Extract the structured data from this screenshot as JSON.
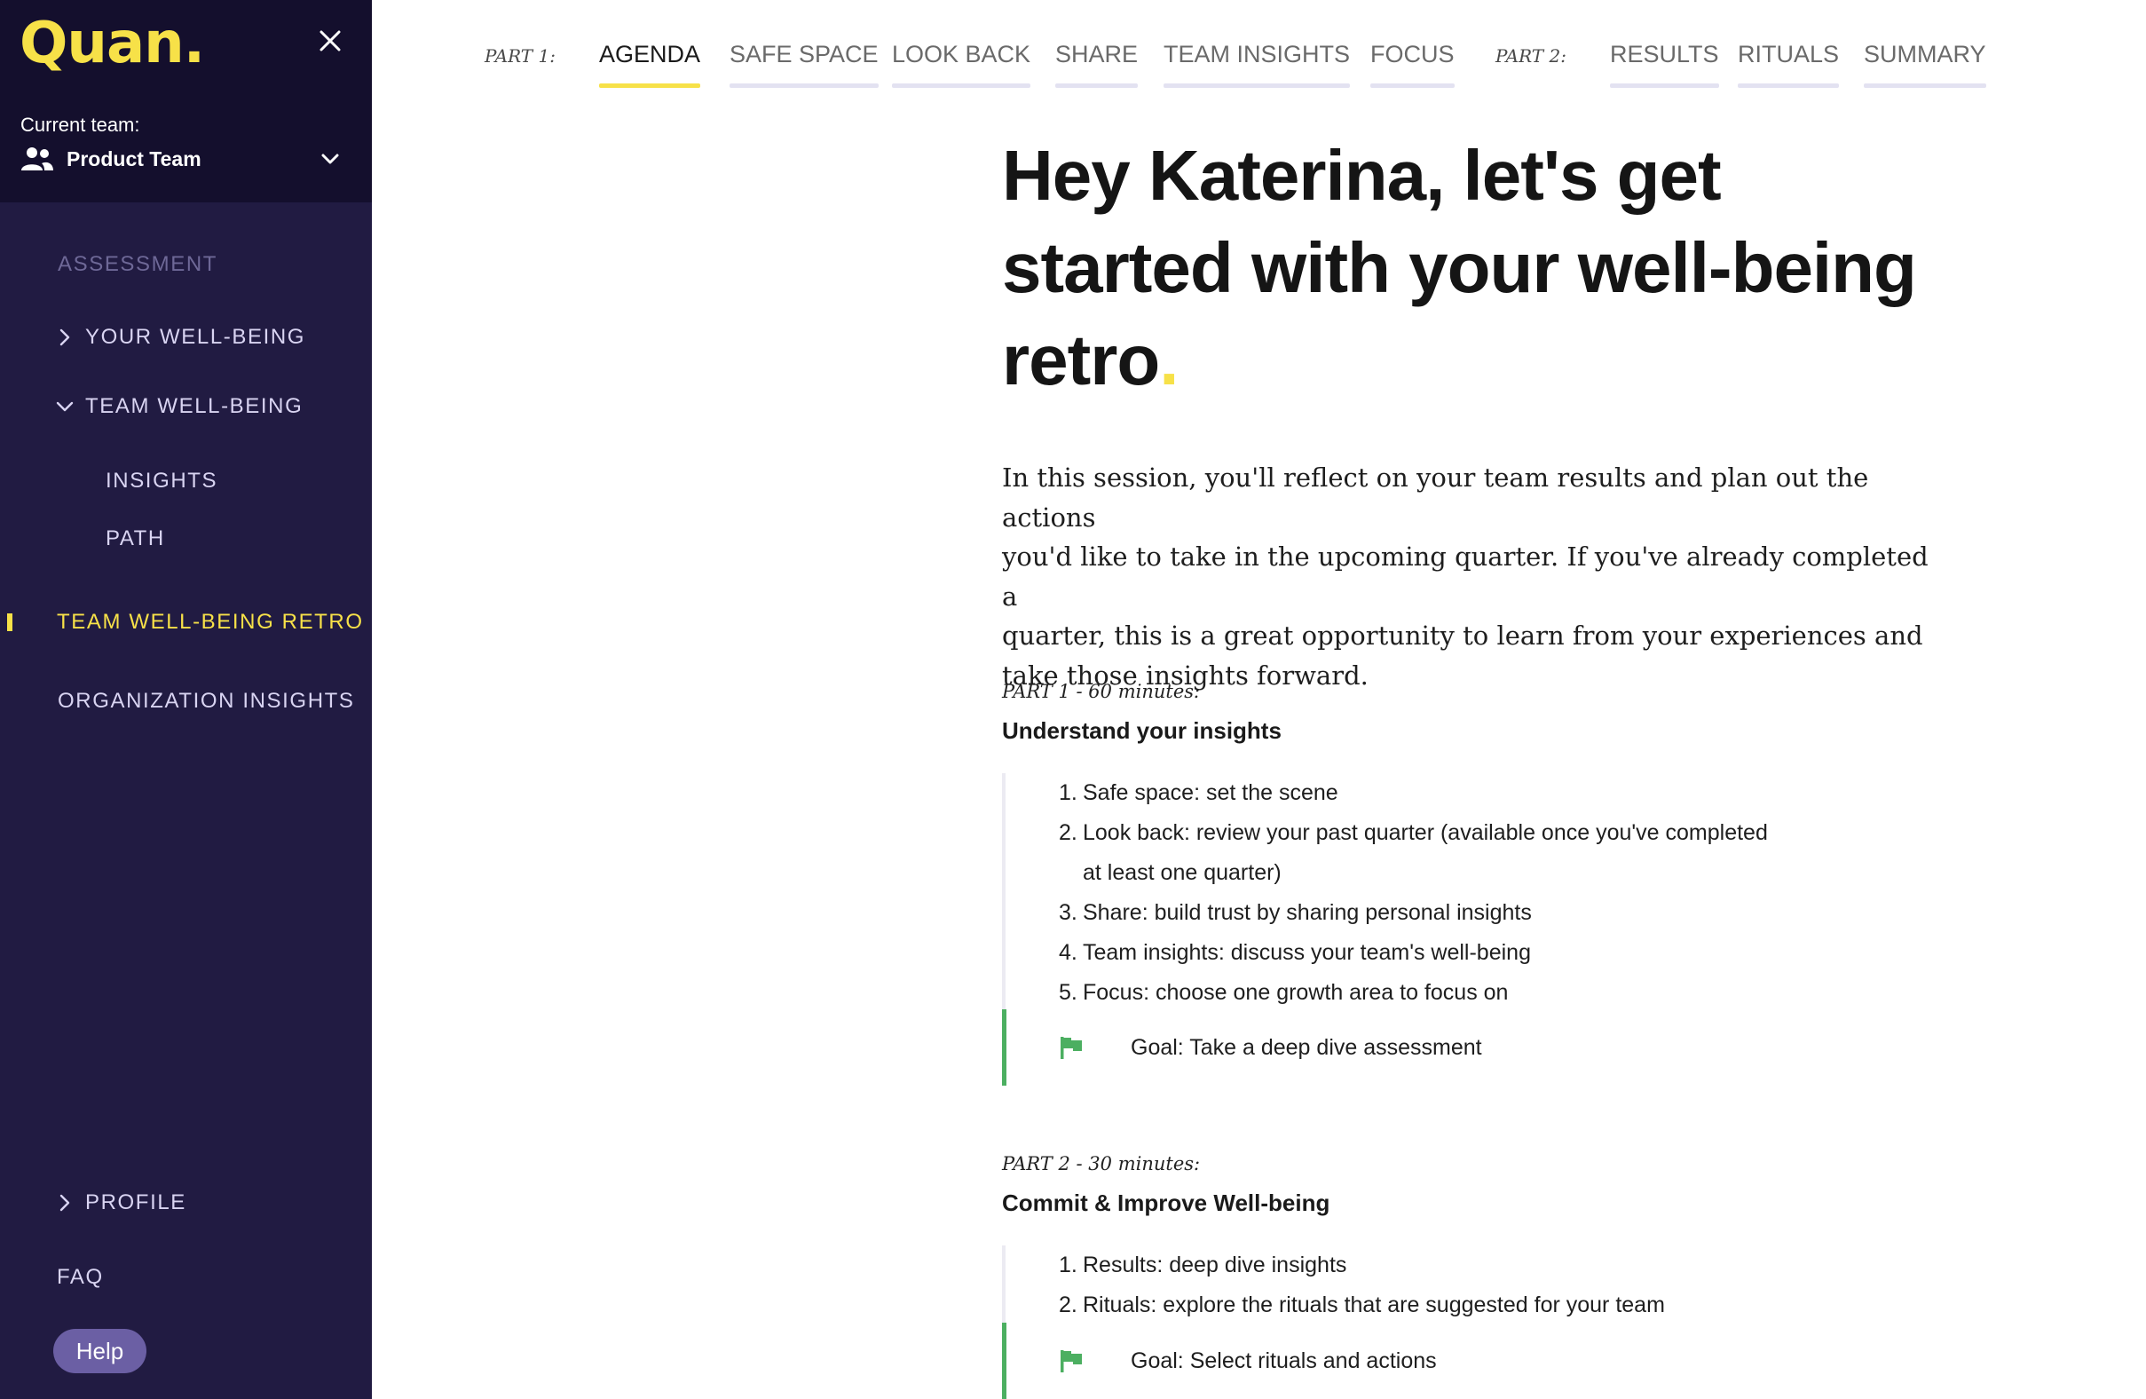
{
  "sidebar": {
    "logo": "Quan.",
    "team_label": "Current team:",
    "team_name": "Product Team",
    "sections": {
      "assessment": "ASSESSMENT"
    },
    "items": [
      {
        "label": "YOUR WELL-BEING"
      },
      {
        "label": "TEAM WELL-BEING"
      },
      {
        "label": "INSIGHTS"
      },
      {
        "label": "PATH"
      },
      {
        "label": "TEAM WELL-BEING RETRO"
      },
      {
        "label": "ORGANIZATION INSIGHTS"
      },
      {
        "label": "PROFILE"
      },
      {
        "label": "FAQ"
      }
    ],
    "help_label": "Help",
    "accent_color": "#f7e148"
  },
  "tabs": {
    "part1_label": "PART 1:",
    "part2_label": "PART 2:",
    "part1": [
      "AGENDA",
      "SAFE SPACE",
      "LOOK BACK",
      "SHARE",
      "TEAM INSIGHTS",
      "FOCUS"
    ],
    "part2": [
      "RESULTS",
      "RITUALS",
      "SUMMARY"
    ],
    "active": "AGENDA"
  },
  "main": {
    "hero_line1": "Hey Katerina, let's get",
    "hero_line2": "started with your well-being",
    "hero_line3": "retro",
    "hero_dot": ".",
    "intro_line1": "In this session, you'll reflect on your team results and plan out the actions",
    "intro_line2": "you'd like to take in the upcoming quarter. If you've already completed a",
    "intro_line3": "quarter, this is a great opportunity to learn from your experiences and",
    "intro_line4": "take those insights forward.",
    "part1": {
      "time": "PART 1 - 60 minutes:",
      "title": "Understand your insights",
      "steps": [
        {
          "num": "1.",
          "text": "Safe space: set the scene"
        },
        {
          "num": "2.",
          "text": "Look back: review your past quarter (available once you've completed",
          "wrap": "at least one quarter)"
        },
        {
          "num": "3.",
          "text": "Share: build trust by sharing personal insights"
        },
        {
          "num": "4.",
          "text": "Team insights: discuss your team's well-being"
        },
        {
          "num": "5.",
          "text": "Focus: choose one growth area to focus on"
        }
      ],
      "goal": "Goal: Take a deep dive assessment"
    },
    "part2": {
      "time": "PART 2 - 30 minutes:",
      "title": "Commit & Improve Well-being",
      "steps": [
        {
          "num": "1.",
          "text": "Results: deep dive insights"
        },
        {
          "num": "2.",
          "text": "Rituals: explore the rituals that are suggested for your team"
        }
      ],
      "goal": "Goal: Select rituals and actions"
    },
    "goal_color": "#4caf61"
  }
}
